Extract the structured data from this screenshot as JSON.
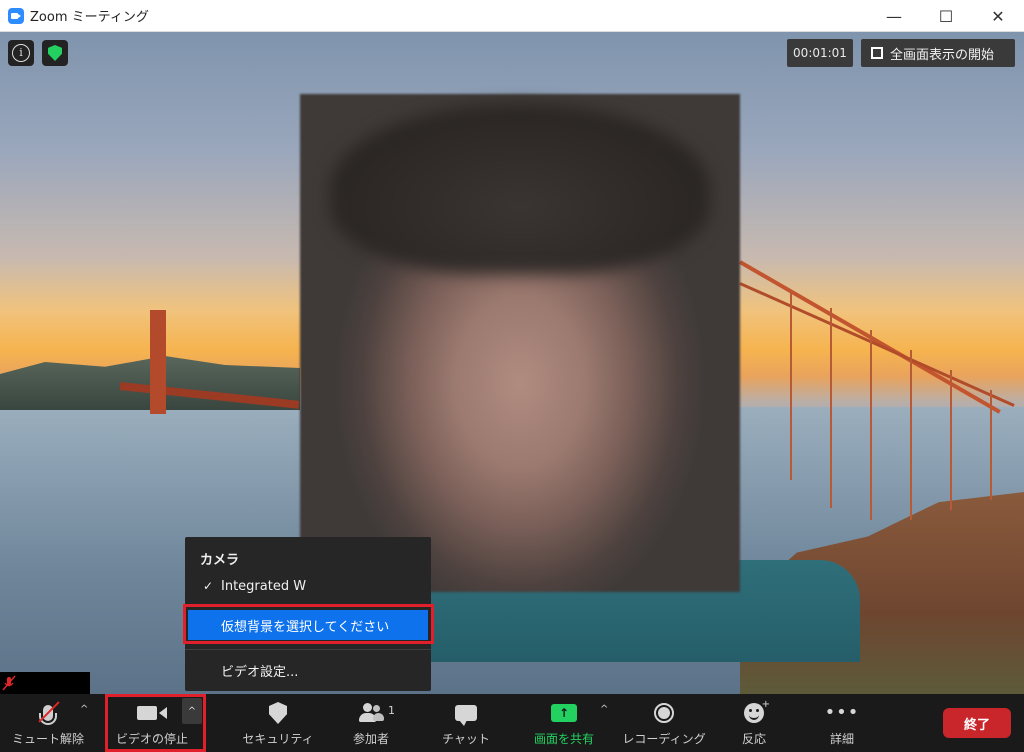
{
  "window": {
    "title": "Zoom ミーティング",
    "minimize": "—",
    "maximize": "☐",
    "close": "✕"
  },
  "top_bar": {
    "info_glyph": "i",
    "timer": "00:01:01",
    "fullscreen_label": "全画面表示の開始"
  },
  "camera_menu": {
    "title": "カメラ",
    "check": "✓",
    "camera_name": "Integrated W",
    "virtual_bg": "仮想背景を選択してください",
    "video_settings": "ビデオ設定..."
  },
  "toolbar": {
    "unmute": "ミュート解除",
    "stop_video": "ビデオの停止",
    "security": "セキュリティ",
    "participants": "参加者",
    "participants_count": "1",
    "chat": "チャット",
    "share_screen": "画面を共有",
    "recording": "レコーディング",
    "reactions": "反応",
    "more": "詳細",
    "end": "終了",
    "caret": "^",
    "share_arrow": "↑",
    "more_dots": "•••",
    "plus": "+"
  },
  "colors": {
    "accent_blue": "#0e72ed",
    "share_green": "#23d160",
    "end_red": "#c9262c",
    "highlight_red": "#e0202a"
  }
}
